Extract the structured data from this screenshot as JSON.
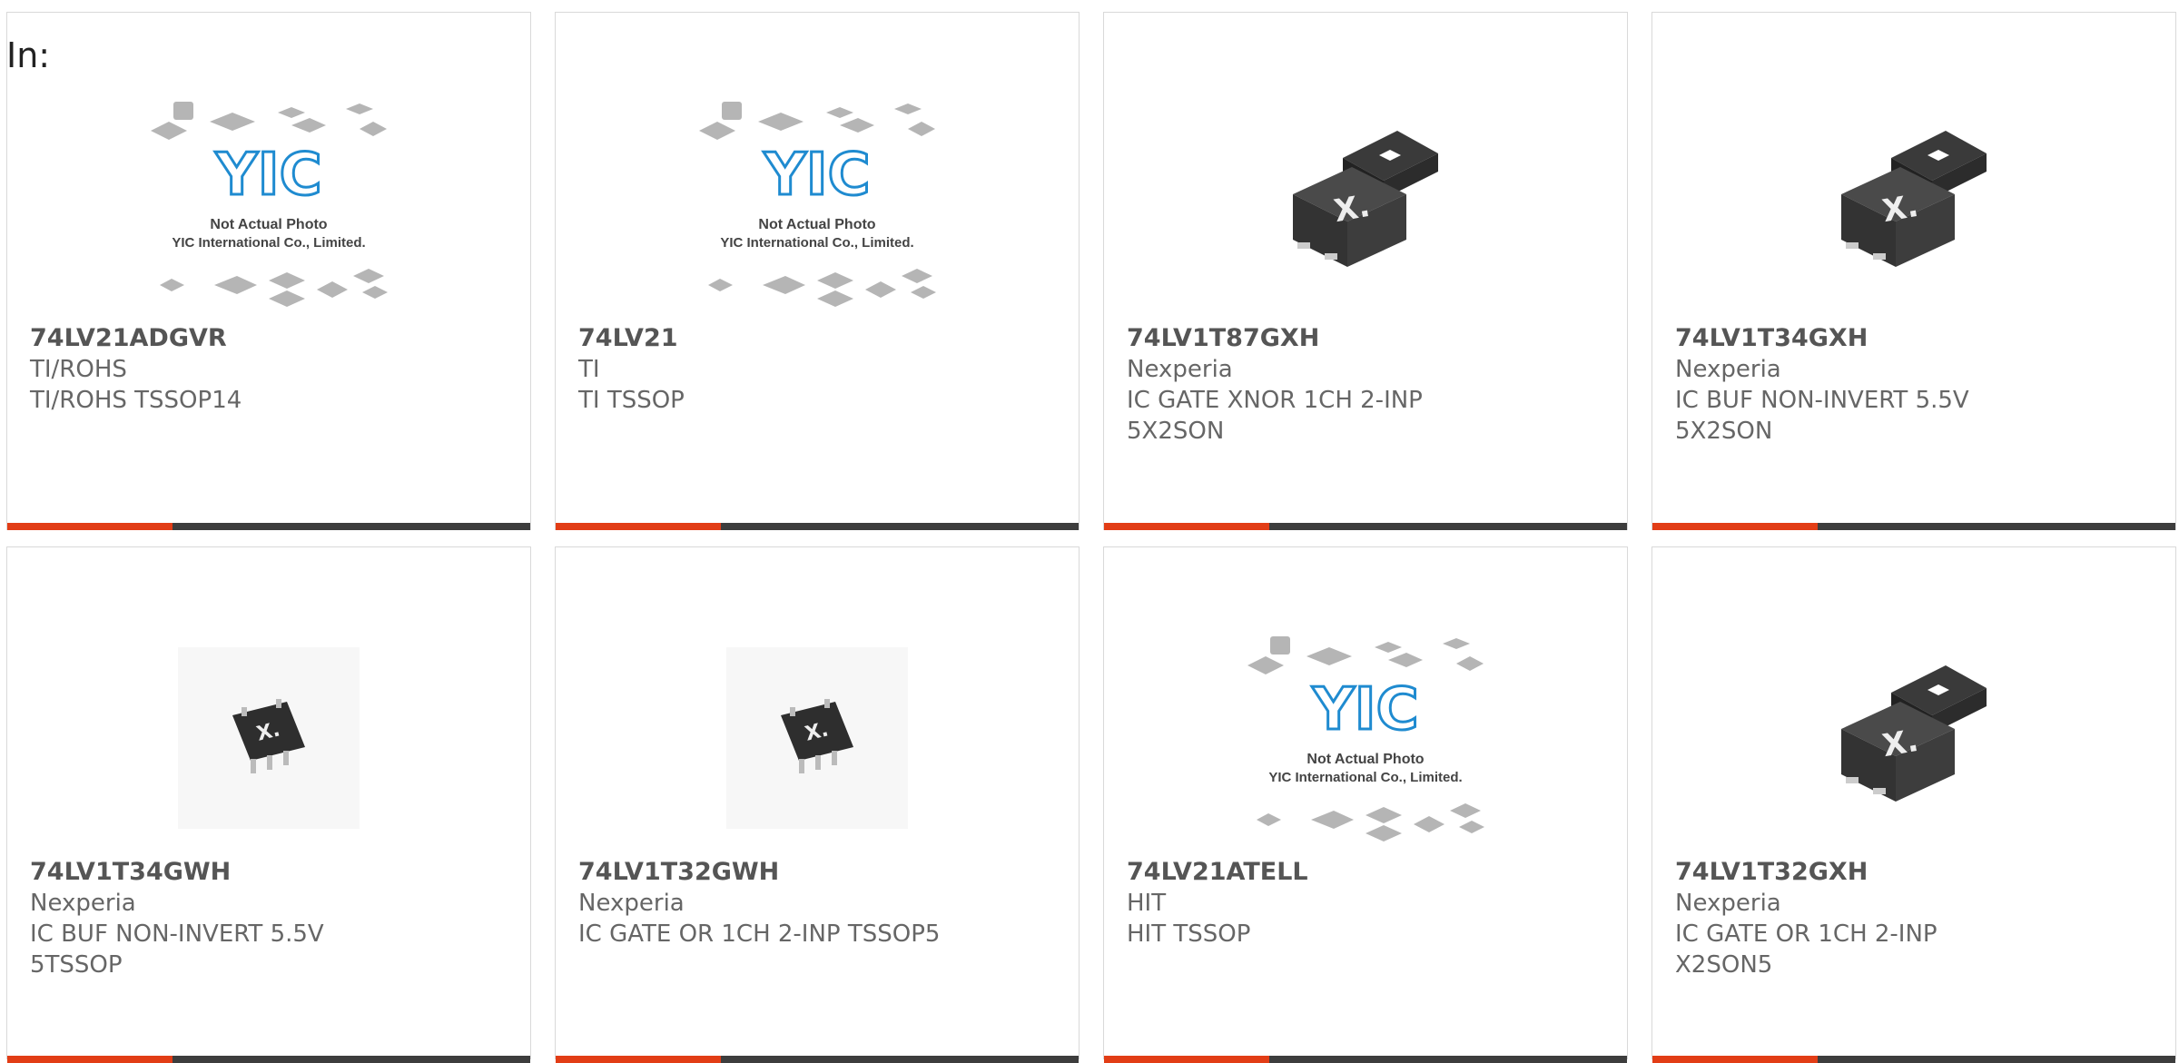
{
  "header": {
    "label": "In:"
  },
  "colors": {
    "accent": "#e23d16",
    "bar": "#3d3d3d"
  },
  "placeholder": {
    "logo": "YIC",
    "line1": "Not Actual Photo",
    "line2": "YIC International Co., Limited."
  },
  "chip_mark": "X.",
  "products": [
    {
      "part": "74LV21ADGVR",
      "maker": "TI/ROHS",
      "desc": "TI/ROHS TSSOP14",
      "image": "yic-placeholder"
    },
    {
      "part": "74LV21",
      "maker": "TI",
      "desc": "TI TSSOP",
      "image": "yic-placeholder"
    },
    {
      "part": "74LV1T87GXH",
      "maker": "Nexperia",
      "desc": "IC GATE XNOR 1CH 2-INP 5X2SON",
      "image": "nexperia-xson"
    },
    {
      "part": "74LV1T34GXH",
      "maker": "Nexperia",
      "desc": "IC BUF NON-INVERT 5.5V 5X2SON",
      "image": "nexperia-xson"
    },
    {
      "part": "74LV1T34GWH",
      "maker": "Nexperia",
      "desc": "IC BUF NON-INVERT 5.5V 5TSSOP",
      "image": "nexperia-tssop5"
    },
    {
      "part": "74LV1T32GWH",
      "maker": "Nexperia",
      "desc": "IC GATE OR 1CH 2-INP TSSOP5",
      "image": "nexperia-tssop5"
    },
    {
      "part": "74LV21ATELL",
      "maker": "HIT",
      "desc": "HIT TSSOP",
      "image": "yic-placeholder"
    },
    {
      "part": "74LV1T32GXH",
      "maker": "Nexperia",
      "desc": "IC GATE OR 1CH 2-INP X2SON5",
      "image": "nexperia-xson"
    }
  ]
}
